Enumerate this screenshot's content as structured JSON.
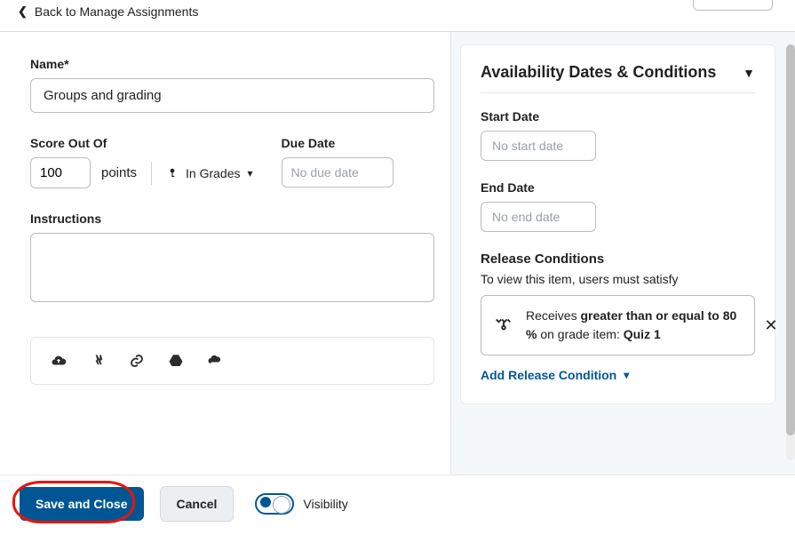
{
  "header": {
    "back_label": "Back to Manage Assignments"
  },
  "left": {
    "name_label": "Name*",
    "name_value": "Groups and grading",
    "score_label": "Score Out Of",
    "score_value": "100",
    "points_label": "points",
    "in_grades_label": "In Grades",
    "due_label": "Due Date",
    "due_placeholder": "No due date",
    "instructions_label": "Instructions",
    "instructions_value": "",
    "attach_icons": [
      "cloud-upload-icon",
      "record-icon",
      "link-icon",
      "google-drive-icon",
      "onedrive-icon"
    ]
  },
  "right": {
    "panel_title": "Availability Dates & Conditions",
    "start_label": "Start Date",
    "start_placeholder": "No start date",
    "end_label": "End Date",
    "end_placeholder": "No end date",
    "release_title": "Release Conditions",
    "release_desc": "To view this item, users must satisfy",
    "condition_prefix": "Receives ",
    "condition_bold": "greater than or equal to 80 %",
    "condition_mid": " on grade item: ",
    "condition_item": "Quiz 1",
    "add_condition_label": "Add Release Condition"
  },
  "footer": {
    "save_label": "Save and Close",
    "cancel_label": "Cancel",
    "visibility_label": "Visibility"
  }
}
